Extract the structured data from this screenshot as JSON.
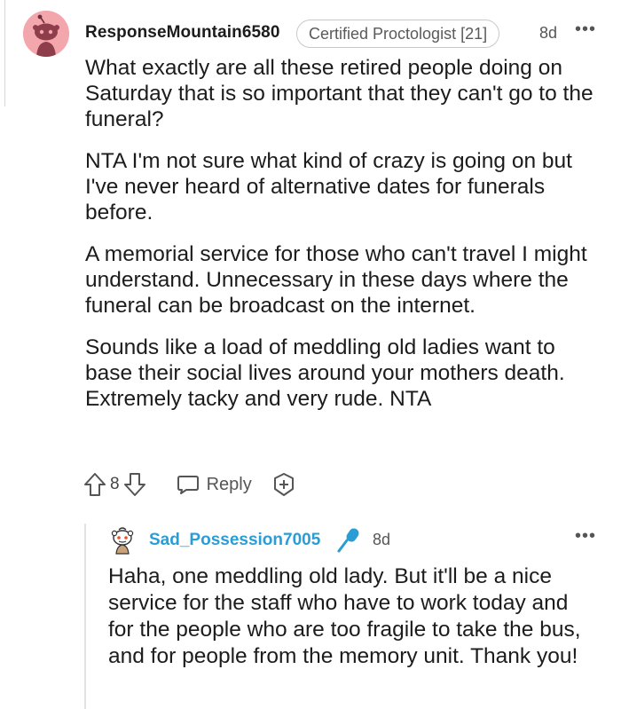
{
  "comment": {
    "username": "ResponseMountain6580",
    "flair": "Certified Proctologist [21]",
    "age": "8d",
    "more": "•••",
    "paragraphs": [
      "What exactly are all these retired people doing on Saturday that is so important that they can't go to the funeral?",
      "NTA I'm not sure what kind of crazy is going on but I've never heard of alternative dates for funerals before.",
      "A memorial service for those who can't travel I might understand. Unnecessary in these days where the funeral can be broadcast on the internet.",
      "Sounds like a load of meddling old ladies want to base their social lives around your mothers death. Extremely tacky and very rude. NTA"
    ],
    "vote_count": "8",
    "reply_label": "Reply"
  },
  "reply": {
    "username": "Sad_Possession7005",
    "age": "8d",
    "more": "•••",
    "text": "Haha, one meddling old lady. But it'll be a nice service for the staff who have to work today and for the people who are too fragile to take the bus, and for people from the memory unit. Thank you!"
  },
  "colors": {
    "avatar_bg": "#f4a6ad",
    "username_blue": "#2a9dd6",
    "text": "#1c1c1c"
  }
}
